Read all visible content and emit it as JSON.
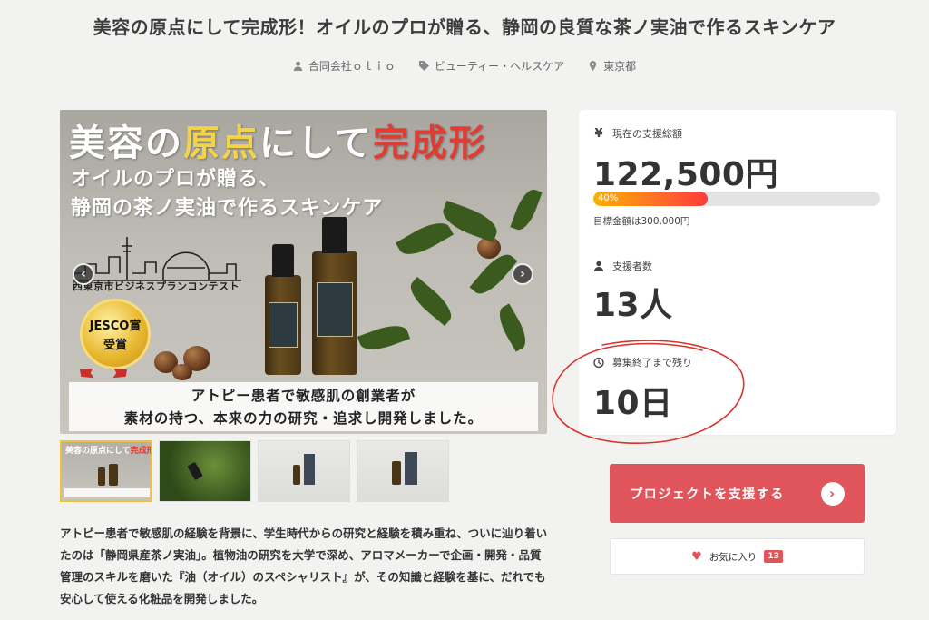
{
  "project": {
    "title": "美容の原点にして完成形！オイルのプロが贈る、静岡の良質な茶ノ実油で作るスキンケア",
    "owner": "合同会社ｏｌｉｏ",
    "category": "ビューティー・ヘルスケア",
    "location": "東京都"
  },
  "hero": {
    "headline_part1": "美容の",
    "headline_part2": "原点",
    "headline_part3": "にして",
    "headline_part4": "完成形",
    "subline1": "オイルのプロが贈る、",
    "subline2": "静岡の茶ノ実油で作るスキンケア",
    "contest": "西東京市ビジネスプランコンテスト",
    "award1": "JESCO賞",
    "award2": "受賞",
    "caption1": "アトピー患者で敏感肌の創業者が",
    "caption2": "素材の持つ、本来の力の研究・追求し開発しました。",
    "prev_label": "‹",
    "next_label": "›"
  },
  "thumbnails": [
    {
      "name": "thumb-1",
      "active": true
    },
    {
      "name": "thumb-2",
      "active": false
    },
    {
      "name": "thumb-3",
      "active": false
    },
    {
      "name": "thumb-4",
      "active": false
    }
  ],
  "description": "アトピー患者で敏感肌の経験を背景に、学生時代からの研究と経験を積み重ね、ついに辿り着いたのは「静岡県産茶ノ実油」。植物油の研究を大学で深め、アロマメーカーで企画・開発・品質管理のスキルを磨いた『油（オイル）のスペシャリスト』が、その知識と経験を基に、だれでも安心して使える化粧品を開発しました。",
  "stats": {
    "raised_label": "現在の支援総額",
    "raised_value": "122,500円",
    "progress_percent": 40,
    "progress_label": "40%",
    "goal_text": "目標金額は300,000円",
    "backers_label": "支援者数",
    "backers_value": "13人",
    "remaining_label": "募集終了まで残り",
    "remaining_value": "10日"
  },
  "actions": {
    "support_label": "プロジェクトを支援する",
    "favorite_label": "お気に入り",
    "favorite_count": "13"
  },
  "colors": {
    "accent": "#e0555b",
    "progress_start": "#ffb100",
    "progress_end": "#ff3b3b",
    "annotation": "#d9342b"
  }
}
